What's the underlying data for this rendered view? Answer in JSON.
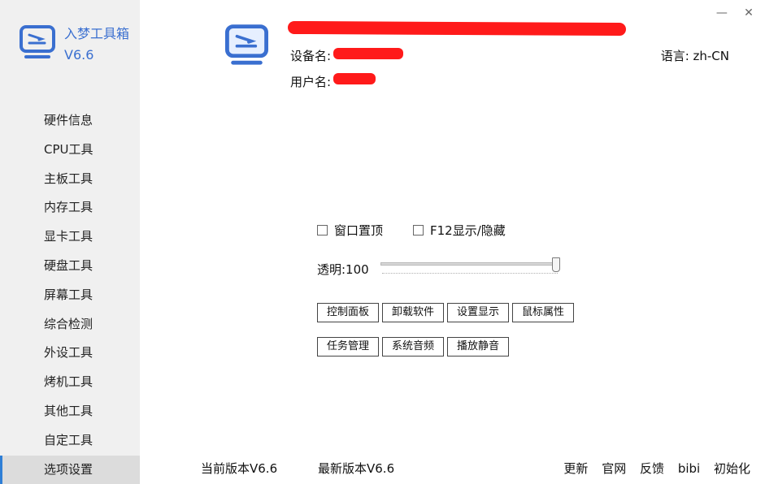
{
  "brand": {
    "name": "入梦工具箱",
    "version": "V6.6",
    "accent_color": "#3a6fd0"
  },
  "window_controls": {
    "minimize": "—",
    "close": "✕"
  },
  "nav": {
    "items": [
      {
        "label": "硬件信息"
      },
      {
        "label": "CPU工具"
      },
      {
        "label": "主板工具"
      },
      {
        "label": "内存工具"
      },
      {
        "label": "显卡工具"
      },
      {
        "label": "硬盘工具"
      },
      {
        "label": "屏幕工具"
      },
      {
        "label": "综合检测"
      },
      {
        "label": "外设工具"
      },
      {
        "label": "烤机工具"
      },
      {
        "label": "其他工具"
      },
      {
        "label": "自定工具"
      },
      {
        "label": "选项设置"
      }
    ],
    "active_index": 12,
    "active_indicator_color": "#2f7fd6"
  },
  "header": {
    "device_label": "设备名:",
    "user_label": "用户名:",
    "language": "语言: zh-CN",
    "redaction_color": "#ff1a1a"
  },
  "options": {
    "always_on_top_label": "窗口置顶",
    "always_on_top_checked": false,
    "f12_toggle_label": "F12显示/隐藏",
    "f12_toggle_checked": false,
    "opacity_label": "透明:100",
    "opacity_value": 100
  },
  "buttons": {
    "control_panel": "控制面板",
    "uninstall_software": "卸载软件",
    "display_settings": "设置显示",
    "mouse_properties": "鼠标属性",
    "task_manager": "任务管理",
    "system_sound": "系统音频",
    "mute_playback": "播放静音"
  },
  "footer": {
    "current_version": "当前版本V6.6",
    "latest_version": "最新版本V6.6",
    "links": [
      "更新",
      "官网",
      "反馈",
      "bibi",
      "初始化"
    ]
  }
}
